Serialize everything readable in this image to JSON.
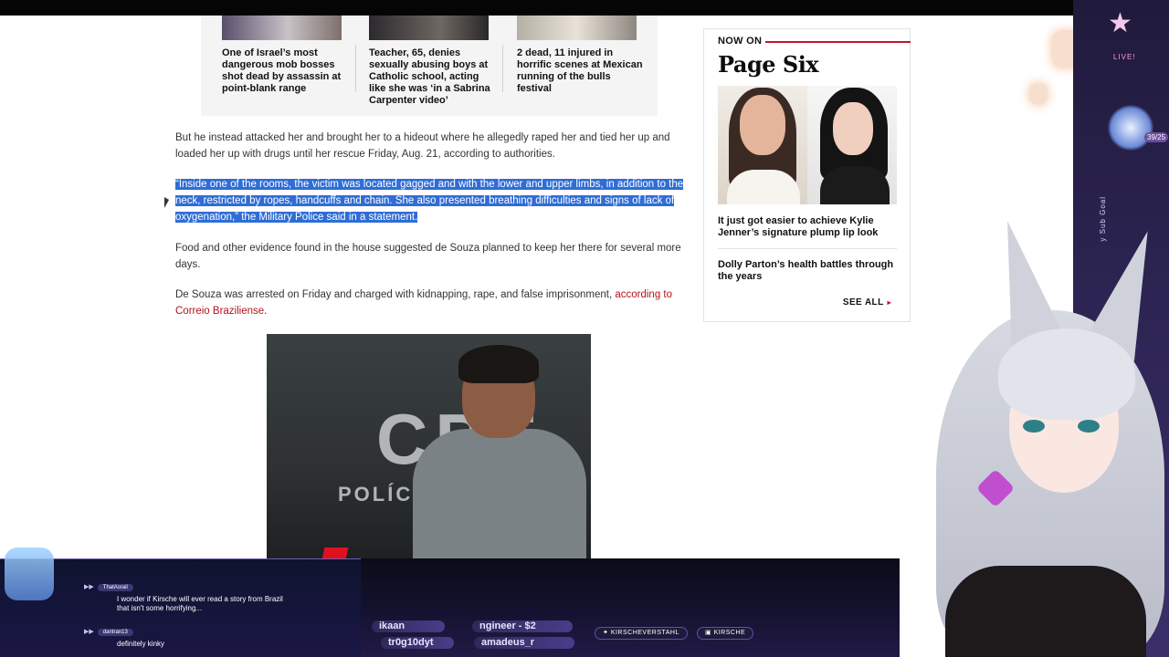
{
  "related": [
    {
      "title": "One of Israel’s most dangerous mob bosses shot dead by assassin at point-blank range"
    },
    {
      "title": "Teacher, 65, denies sexually abusing boys at Catholic school, acting like she was ‘in a Sabrina Carpenter video’"
    },
    {
      "title": "2 dead, 11 injured in horrific scenes at Mexican running of the bulls festival"
    }
  ],
  "article": {
    "p1": "But he instead attacked her and brought her to a hideout where he allegedly raped her and tied her up and loaded her up with drugs until her rescue Friday, Aug. 21, according to authorities.",
    "p2_quote": "“Inside one of the rooms, the victim was located gagged and with the lower and upper limbs, in addition to the neck, restricted by ropes, handcuffs and chain. She also presented breathing difficulties and signs of lack of oxygenation,” the Military Police said in a statement.",
    "p3": "Food and other evidence found in the house suggested de Souza planned to keep her there for several more days.",
    "p4_text": "De Souza was arrested on Friday and charged with kidnapping, rape, and false imprisonment, ",
    "p4_link": "according to Correio Braziliense",
    "p4_end": ".",
    "photo_text_1": "CPE",
    "photo_text_2": "POLÍCIA"
  },
  "sidebar": {
    "now_on": "NOW ON",
    "brand": "Page Six",
    "stories": [
      {
        "title": "It just got easier to achieve Kylie Jenner’s signature plump lip look"
      },
      {
        "title": "Dolly Parton’s health battles through the years"
      }
    ],
    "see_all": "SEE ALL",
    "see_all_arrow": "▸"
  },
  "overlay": {
    "live_label": "LIVE!",
    "goal_counter": "39/25",
    "sub_goal_label": "y Sub Goal",
    "chat": [
      {
        "user": "ThatAsrail",
        "text": "I wonder if Kirsche will ever read a story from Brazil that isn't some horrifying..."
      },
      {
        "user": "dantran13",
        "text": "definitely kinky"
      }
    ],
    "ticker": [
      "ikaan",
      "ngineer - $2",
      "tr0g10dyt",
      "amadeus_r"
    ],
    "social": [
      {
        "label": "KIRSCHEVERSTAHL",
        "icon": "twitter-icon"
      },
      {
        "label": "KIRSCHE",
        "icon": "chat-bubble-icon"
      }
    ]
  },
  "colors": {
    "highlight": "#2f6dd6",
    "link": "#b5121b",
    "brand_red": "#c8102e"
  }
}
